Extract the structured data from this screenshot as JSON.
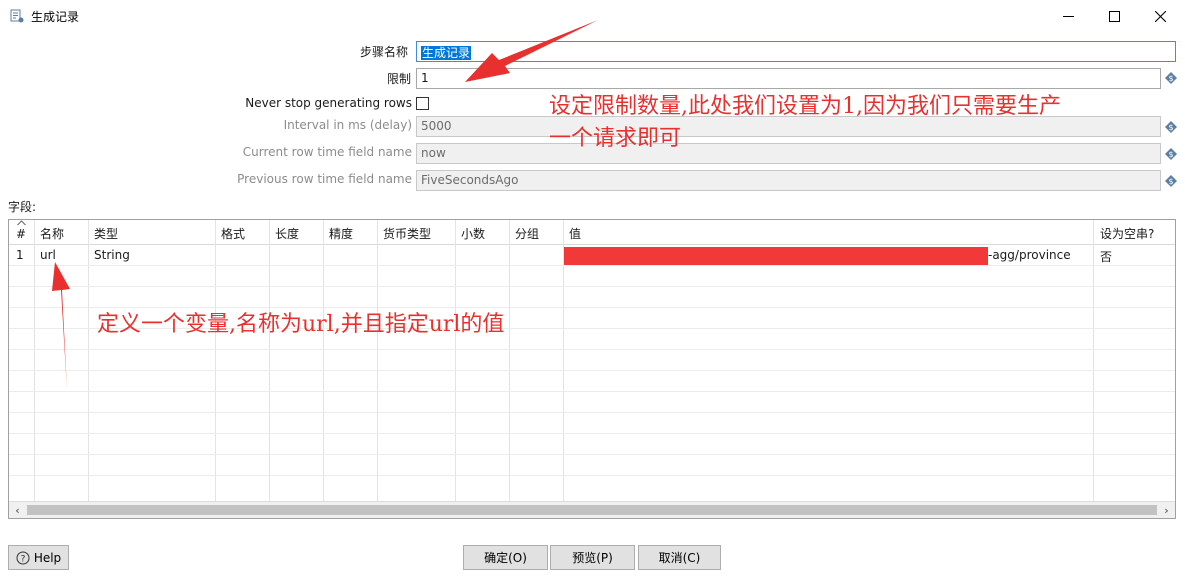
{
  "window": {
    "title": "生成记录"
  },
  "form": {
    "step_name_label": "步骤名称",
    "step_name_value": "生成记录",
    "limit_label": "限制",
    "limit_value": "1",
    "never_stop_label": "Never stop generating rows",
    "never_stop_checked": false,
    "interval_label": "Interval in ms (delay)",
    "interval_value": "5000",
    "current_row_label": "Current row time field name",
    "current_row_value": "now",
    "previous_row_label": "Previous row time field name",
    "previous_row_value": "FiveSecondsAgo"
  },
  "fields": {
    "label": "字段:",
    "columns": [
      "#",
      "名称",
      "类型",
      "格式",
      "长度",
      "精度",
      "货币类型",
      "小数",
      "分组",
      "值",
      "设为空串?"
    ],
    "rows": [
      {
        "num": "1",
        "name": "url",
        "type": "String",
        "format": "",
        "length": "",
        "precision": "",
        "currency": "",
        "decimal": "",
        "group": "",
        "value": "-agg/province",
        "empty": "否"
      }
    ]
  },
  "buttons": {
    "help": "Help",
    "ok": "确定(O)",
    "preview": "预览(P)",
    "cancel": "取消(C)"
  },
  "annotations": {
    "limit_note_line1": "设定限制数量,此处我们设置为1,因为我们只需要生产",
    "limit_note_line2": "一个请求即可",
    "field_note": "定义一个变量,名称为url,并且指定url的值"
  },
  "colors": {
    "annotation": "#e8302f",
    "selection": "#0078d7",
    "redaction": "#f2393a"
  }
}
